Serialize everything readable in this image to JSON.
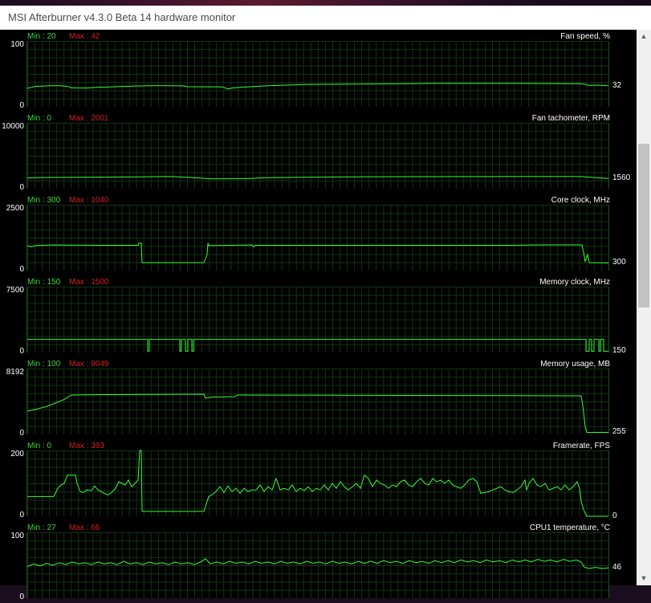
{
  "window": {
    "title": "MSI Afterburner v4.3.0 Beta 14 hardware monitor"
  },
  "colors": {
    "line": "#33ff33",
    "min_text": "#3fd83f",
    "max_text": "#d42020",
    "grid": "#133513",
    "background": "#000000"
  },
  "scrollbar": {
    "up_icon": "chevron-up-icon",
    "down_icon": "chevron-down-icon",
    "thumb_start": 0.19,
    "thumb_end": 0.5
  },
  "graphs": [
    {
      "name": "Fan speed, %",
      "min_label": "Min : 20",
      "max_label": "Max : 42",
      "ymax_label": "100",
      "ymin_label": "0",
      "current_label": "32",
      "range": [
        0,
        100
      ],
      "current": 32,
      "series": [
        [
          0,
          28
        ],
        [
          3,
          29
        ],
        [
          5,
          29.5
        ],
        [
          10,
          31
        ],
        [
          20,
          31.5
        ],
        [
          30,
          32
        ],
        [
          40,
          32
        ],
        [
          50,
          31
        ],
        [
          55,
          29
        ],
        [
          60,
          28.7
        ],
        [
          70,
          28.5
        ],
        [
          75,
          28.5
        ],
        [
          85,
          29.5
        ],
        [
          100,
          30
        ],
        [
          120,
          31
        ],
        [
          135,
          31.5
        ],
        [
          155,
          32
        ],
        [
          180,
          32
        ],
        [
          195,
          31.7
        ],
        [
          200,
          30.5
        ],
        [
          240,
          30.3
        ],
        [
          245,
          29.5
        ],
        [
          250,
          27
        ],
        [
          255,
          28.5
        ],
        [
          265,
          29.5
        ],
        [
          300,
          32
        ],
        [
          350,
          34
        ],
        [
          400,
          34.5
        ],
        [
          470,
          35
        ],
        [
          500,
          35.5
        ],
        [
          600,
          35.5
        ],
        [
          690,
          35
        ],
        [
          695,
          34
        ],
        [
          700,
          32.5
        ],
        [
          710,
          33
        ],
        [
          724,
          32
        ]
      ]
    },
    {
      "name": "Fan tachometer, RPM",
      "min_label": "Min : 0",
      "max_label": "Max : 2001",
      "ymax_label": "10000",
      "ymin_label": "0",
      "current_label": "1560",
      "range": [
        0,
        10000
      ],
      "current": 1560,
      "series": [
        [
          0,
          1650
        ],
        [
          20,
          1700
        ],
        [
          60,
          1720
        ],
        [
          100,
          1750
        ],
        [
          140,
          1800
        ],
        [
          170,
          1850
        ],
        [
          180,
          1850
        ],
        [
          195,
          1750
        ],
        [
          230,
          1500
        ],
        [
          270,
          1530
        ],
        [
          300,
          1680
        ],
        [
          400,
          1800
        ],
        [
          500,
          1830
        ],
        [
          600,
          1850
        ],
        [
          690,
          1850
        ],
        [
          700,
          1750
        ],
        [
          715,
          1620
        ],
        [
          724,
          1560
        ]
      ]
    },
    {
      "name": "Core clock, MHz",
      "min_label": "Min : 300",
      "max_label": "Max : 1040",
      "ymax_label": "2500",
      "ymin_label": "0",
      "current_label": "300",
      "range": [
        0,
        2500
      ],
      "current": 300,
      "series": [
        [
          0,
          950
        ],
        [
          5,
          900
        ],
        [
          10,
          950
        ],
        [
          30,
          970
        ],
        [
          100,
          960
        ],
        [
          138,
          960
        ],
        [
          139,
          1040
        ],
        [
          142,
          1040
        ],
        [
          143,
          300
        ],
        [
          220,
          300
        ],
        [
          224,
          600
        ],
        [
          225,
          1040
        ],
        [
          226,
          950
        ],
        [
          280,
          970
        ],
        [
          282,
          900
        ],
        [
          284,
          960
        ],
        [
          600,
          960
        ],
        [
          640,
          975
        ],
        [
          691,
          975
        ],
        [
          693,
          700
        ],
        [
          695,
          350
        ],
        [
          698,
          600
        ],
        [
          700,
          300
        ],
        [
          724,
          290
        ]
      ]
    },
    {
      "name": "Memory clock, MHz",
      "min_label": "Min : 150",
      "max_label": "Max : 1500",
      "ymax_label": "7500",
      "ymin_label": "0",
      "current_label": "150",
      "range": [
        0,
        7500
      ],
      "current": 150,
      "series": [
        [
          0,
          1500
        ],
        [
          150,
          1500
        ],
        [
          150,
          150
        ],
        [
          152,
          150
        ],
        [
          152,
          1500
        ],
        [
          190,
          1500
        ],
        [
          190,
          150
        ],
        [
          192,
          150
        ],
        [
          192,
          1500
        ],
        [
          197,
          1500
        ],
        [
          197,
          150
        ],
        [
          200,
          150
        ],
        [
          200,
          1500
        ],
        [
          205,
          1500
        ],
        [
          205,
          150
        ],
        [
          207,
          150
        ],
        [
          207,
          1500
        ],
        [
          696,
          1500
        ],
        [
          696,
          150
        ],
        [
          700,
          150
        ],
        [
          700,
          1500
        ],
        [
          703,
          1500
        ],
        [
          703,
          150
        ],
        [
          706,
          150
        ],
        [
          706,
          1500
        ],
        [
          712,
          1500
        ],
        [
          712,
          150
        ],
        [
          714,
          150
        ],
        [
          714,
          1500
        ],
        [
          718,
          1500
        ],
        [
          718,
          150
        ],
        [
          724,
          150
        ]
      ]
    },
    {
      "name": "Memory usage, MB",
      "min_label": "Min : 100",
      "max_label": "Max : 8049",
      "ymax_label": "8192",
      "ymin_label": "0",
      "current_label": "255",
      "range": [
        0,
        8192
      ],
      "current": 255,
      "series": [
        [
          0,
          2900
        ],
        [
          10,
          3100
        ],
        [
          25,
          3500
        ],
        [
          45,
          4300
        ],
        [
          55,
          4900
        ],
        [
          100,
          4950
        ],
        [
          220,
          5000
        ],
        [
          222,
          4500
        ],
        [
          230,
          4650
        ],
        [
          258,
          4700
        ],
        [
          262,
          4900
        ],
        [
          690,
          4800
        ],
        [
          692,
          3600
        ],
        [
          695,
          1000
        ],
        [
          697,
          255
        ],
        [
          724,
          255
        ]
      ]
    },
    {
      "name": "Framerate, FPS",
      "min_label": "Min : 0",
      "max_label": "Max : 393",
      "ymax_label": "200",
      "ymin_label": "0",
      "current_label": "0",
      "range": [
        0,
        200
      ],
      "current": 0,
      "series": [
        [
          0,
          60
        ],
        [
          33,
          60
        ],
        [
          36,
          75
        ],
        [
          38,
          85
        ],
        [
          42,
          95
        ],
        [
          46,
          100
        ],
        [
          50,
          125
        ],
        [
          52,
          125
        ],
        [
          55,
          125
        ],
        [
          60,
          125
        ],
        [
          62,
          100
        ],
        [
          66,
          75
        ],
        [
          70,
          72
        ],
        [
          74,
          80
        ],
        [
          80,
          78
        ],
        [
          84,
          92
        ],
        [
          88,
          80
        ],
        [
          92,
          75
        ],
        [
          96,
          70
        ],
        [
          100,
          65
        ],
        [
          104,
          70
        ],
        [
          110,
          85
        ],
        [
          114,
          105
        ],
        [
          118,
          100
        ],
        [
          122,
          95
        ],
        [
          126,
          110
        ],
        [
          130,
          90
        ],
        [
          134,
          100
        ],
        [
          138,
          110
        ],
        [
          140,
          200
        ],
        [
          142,
          200
        ],
        [
          143,
          15
        ],
        [
          220,
          15
        ],
        [
          224,
          45
        ],
        [
          226,
          60
        ],
        [
          230,
          65
        ],
        [
          235,
          75
        ],
        [
          240,
          90
        ],
        [
          245,
          72
        ],
        [
          250,
          92
        ],
        [
          255,
          75
        ],
        [
          260,
          85
        ],
        [
          265,
          70
        ],
        [
          270,
          85
        ],
        [
          275,
          75
        ],
        [
          280,
          80
        ],
        [
          285,
          80
        ],
        [
          290,
          95
        ],
        [
          295,
          75
        ],
        [
          300,
          90
        ],
        [
          305,
          80
        ],
        [
          310,
          115
        ],
        [
          315,
          80
        ],
        [
          320,
          85
        ],
        [
          325,
          80
        ],
        [
          330,
          95
        ],
        [
          335,
          75
        ],
        [
          340,
          85
        ],
        [
          345,
          78
        ],
        [
          350,
          90
        ],
        [
          355,
          75
        ],
        [
          360,
          85
        ],
        [
          365,
          80
        ],
        [
          370,
          95
        ],
        [
          375,
          80
        ],
        [
          380,
          100
        ],
        [
          385,
          85
        ],
        [
          390,
          105
        ],
        [
          395,
          90
        ],
        [
          400,
          80
        ],
        [
          405,
          90
        ],
        [
          410,
          100
        ],
        [
          415,
          85
        ],
        [
          420,
          125
        ],
        [
          425,
          115
        ],
        [
          430,
          90
        ],
        [
          435,
          110
        ],
        [
          440,
          100
        ],
        [
          445,
          95
        ],
        [
          450,
          85
        ],
        [
          455,
          95
        ],
        [
          460,
          90
        ],
        [
          465,
          105
        ],
        [
          470,
          110
        ],
        [
          475,
          95
        ],
        [
          480,
          90
        ],
        [
          485,
          105
        ],
        [
          490,
          115
        ],
        [
          495,
          100
        ],
        [
          500,
          95
        ],
        [
          505,
          115
        ],
        [
          510,
          105
        ],
        [
          515,
          110
        ],
        [
          520,
          100
        ],
        [
          525,
          110
        ],
        [
          530,
          95
        ],
        [
          535,
          90
        ],
        [
          540,
          85
        ],
        [
          545,
          95
        ],
        [
          550,
          110
        ],
        [
          555,
          115
        ],
        [
          560,
          105
        ],
        [
          565,
          70
        ],
        [
          570,
          72
        ],
        [
          575,
          75
        ],
        [
          580,
          80
        ],
        [
          585,
          85
        ],
        [
          590,
          90
        ],
        [
          595,
          80
        ],
        [
          600,
          75
        ],
        [
          605,
          72
        ],
        [
          610,
          80
        ],
        [
          615,
          90
        ],
        [
          620,
          110
        ],
        [
          622,
          80
        ],
        [
          625,
          100
        ],
        [
          630,
          115
        ],
        [
          635,
          95
        ],
        [
          640,
          90
        ],
        [
          645,
          100
        ],
        [
          650,
          80
        ],
        [
          655,
          85
        ],
        [
          660,
          90
        ],
        [
          665,
          80
        ],
        [
          670,
          95
        ],
        [
          675,
          80
        ],
        [
          680,
          90
        ],
        [
          685,
          105
        ],
        [
          688,
          85
        ],
        [
          690,
          45
        ],
        [
          693,
          20
        ],
        [
          697,
          0
        ],
        [
          724,
          0
        ]
      ]
    },
    {
      "name": "CPU1 temperature, °C",
      "min_label": "Min : 27",
      "max_label": "Max : 66",
      "ymax_label": "100",
      "ymin_label": "0",
      "current_label": "46",
      "range": [
        0,
        100
      ],
      "current": 46,
      "series": [
        [
          0,
          48
        ],
        [
          8,
          52
        ],
        [
          16,
          49
        ],
        [
          24,
          53
        ],
        [
          32,
          50
        ],
        [
          40,
          54
        ],
        [
          48,
          51
        ],
        [
          56,
          55
        ],
        [
          64,
          52
        ],
        [
          72,
          54
        ],
        [
          80,
          51
        ],
        [
          88,
          55
        ],
        [
          96,
          52
        ],
        [
          104,
          54
        ],
        [
          112,
          51
        ],
        [
          120,
          56
        ],
        [
          128,
          52
        ],
        [
          136,
          54
        ],
        [
          144,
          51
        ],
        [
          152,
          55
        ],
        [
          160,
          52
        ],
        [
          168,
          54
        ],
        [
          176,
          51
        ],
        [
          184,
          55
        ],
        [
          192,
          52
        ],
        [
          200,
          54
        ],
        [
          208,
          51
        ],
        [
          216,
          55
        ],
        [
          222,
          60
        ],
        [
          228,
          52
        ],
        [
          236,
          55
        ],
        [
          244,
          52
        ],
        [
          252,
          56
        ],
        [
          260,
          53
        ],
        [
          268,
          55
        ],
        [
          276,
          52
        ],
        [
          284,
          56
        ],
        [
          292,
          53
        ],
        [
          300,
          55
        ],
        [
          308,
          52
        ],
        [
          316,
          56
        ],
        [
          324,
          53
        ],
        [
          332,
          55
        ],
        [
          340,
          52
        ],
        [
          348,
          56
        ],
        [
          356,
          53
        ],
        [
          364,
          55
        ],
        [
          372,
          52
        ],
        [
          380,
          56
        ],
        [
          388,
          53
        ],
        [
          396,
          55
        ],
        [
          404,
          52
        ],
        [
          412,
          56
        ],
        [
          420,
          53
        ],
        [
          428,
          56
        ],
        [
          436,
          53
        ],
        [
          444,
          57
        ],
        [
          452,
          54
        ],
        [
          460,
          56
        ],
        [
          468,
          53
        ],
        [
          476,
          57
        ],
        [
          484,
          54
        ],
        [
          492,
          56
        ],
        [
          500,
          53
        ],
        [
          508,
          57
        ],
        [
          516,
          54
        ],
        [
          524,
          57
        ],
        [
          532,
          54
        ],
        [
          540,
          58
        ],
        [
          548,
          55
        ],
        [
          556,
          57
        ],
        [
          564,
          54
        ],
        [
          572,
          58
        ],
        [
          580,
          55
        ],
        [
          588,
          57
        ],
        [
          596,
          54
        ],
        [
          604,
          58
        ],
        [
          612,
          55
        ],
        [
          620,
          58
        ],
        [
          628,
          55
        ],
        [
          636,
          59
        ],
        [
          644,
          56
        ],
        [
          652,
          58
        ],
        [
          660,
          55
        ],
        [
          668,
          59
        ],
        [
          676,
          56
        ],
        [
          684,
          58
        ],
        [
          690,
          55
        ],
        [
          694,
          47
        ],
        [
          700,
          45
        ],
        [
          708,
          47
        ],
        [
          716,
          45
        ],
        [
          724,
          46
        ]
      ]
    }
  ]
}
